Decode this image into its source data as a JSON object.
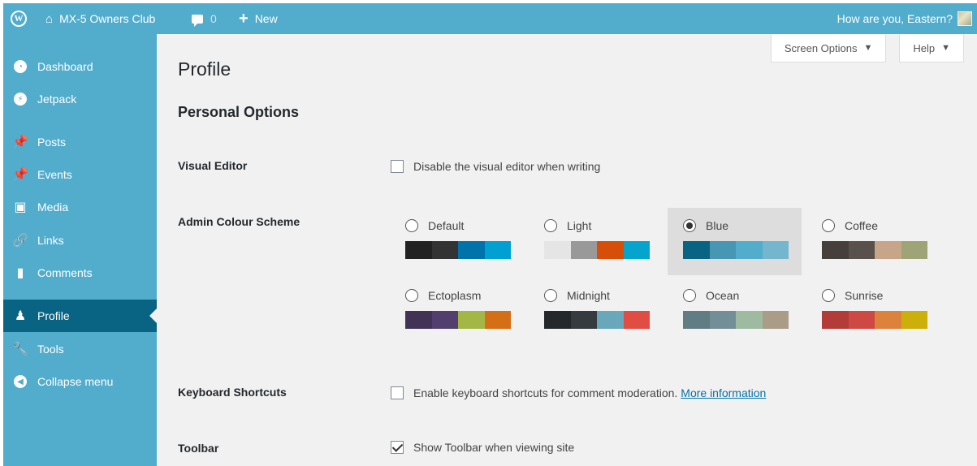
{
  "adminbar": {
    "wp_logo": "W",
    "site_name": "MX-5 Owners Club",
    "comments_count": "0",
    "new_label": "New",
    "greeting": "How are you, Eastern?"
  },
  "sidebar": {
    "items": [
      {
        "label": "Dashboard",
        "icon": "dashboard-icon"
      },
      {
        "label": "Jetpack",
        "icon": "jetpack-icon"
      },
      {
        "label": "Posts",
        "icon": "pin-icon"
      },
      {
        "label": "Events",
        "icon": "pin-icon"
      },
      {
        "label": "Media",
        "icon": "media-icon"
      },
      {
        "label": "Links",
        "icon": "link-icon"
      },
      {
        "label": "Comments",
        "icon": "comment-icon"
      },
      {
        "label": "Profile",
        "icon": "user-icon"
      },
      {
        "label": "Tools",
        "icon": "wrench-icon"
      },
      {
        "label": "Collapse menu",
        "icon": "collapse-icon"
      }
    ]
  },
  "screen_tabs": {
    "screen_options": "Screen Options",
    "help": "Help"
  },
  "main": {
    "title": "Profile",
    "section_title": "Personal Options",
    "visual_editor": {
      "label": "Visual Editor",
      "checkbox_text": "Disable the visual editor when writing",
      "checked": false
    },
    "colour_scheme": {
      "label": "Admin Colour Scheme",
      "selected": "Blue",
      "schemes": [
        {
          "name": "Default",
          "colors": [
            "#222222",
            "#333333",
            "#0073aa",
            "#00a0d2"
          ]
        },
        {
          "name": "Light",
          "colors": [
            "#e5e5e5",
            "#999999",
            "#d64e07",
            "#04a4cc"
          ]
        },
        {
          "name": "Blue",
          "colors": [
            "#096484",
            "#4796b3",
            "#52accc",
            "#74b6ce"
          ]
        },
        {
          "name": "Coffee",
          "colors": [
            "#46403c",
            "#59524c",
            "#c7a589",
            "#9ea476"
          ]
        },
        {
          "name": "Ectoplasm",
          "colors": [
            "#413256",
            "#523f6d",
            "#a3b745",
            "#d46f15"
          ]
        },
        {
          "name": "Midnight",
          "colors": [
            "#25282b",
            "#363b3f",
            "#69a8bb",
            "#e14d43"
          ]
        },
        {
          "name": "Ocean",
          "colors": [
            "#627c83",
            "#738e96",
            "#9ebaa0",
            "#aa9d88"
          ]
        },
        {
          "name": "Sunrise",
          "colors": [
            "#b43c38",
            "#cf4944",
            "#dd823b",
            "#ccaf0b"
          ]
        }
      ]
    },
    "keyboard_shortcuts": {
      "label": "Keyboard Shortcuts",
      "checkbox_text": "Enable keyboard shortcuts for comment moderation.",
      "link_text": "More information",
      "checked": false
    },
    "toolbar": {
      "label": "Toolbar",
      "checkbox_text": "Show Toolbar when viewing site",
      "checked": true
    }
  },
  "colors": {
    "accent": "#52accc",
    "current": "#096484",
    "link": "#0073aa"
  }
}
